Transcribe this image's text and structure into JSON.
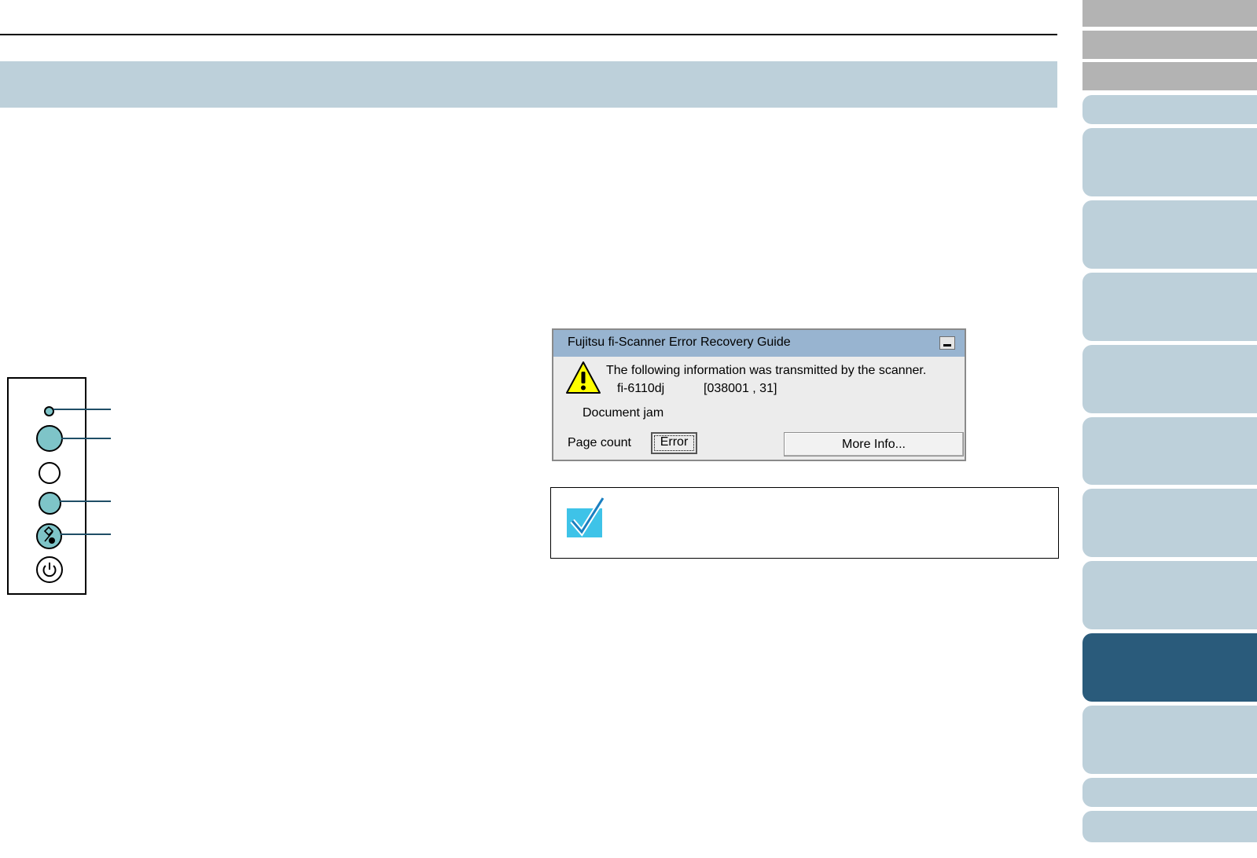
{
  "dialog": {
    "title": "Fujitsu fi-Scanner Error Recovery Guide",
    "message": "The following information was transmitted by the scanner.",
    "model": "fi-6110dj",
    "code": "[038001 , 31]",
    "error_text": "Document jam",
    "page_count_label": "Page count",
    "error_button": "Error",
    "more_info_button": "More Info..."
  },
  "colors": {
    "title_band": "#bdd0da",
    "nav_tab": "#bdd0da",
    "nav_tab_active": "#2a5b7b",
    "nav_tab_gray": "#b3b3b3",
    "led_lit": "#7ec4c8",
    "dialog_titlebar": "#98b4d0"
  },
  "icons": [
    "warning-icon",
    "hint-check-icon",
    "minimize-icon",
    "scan-stop-icon",
    "power-icon"
  ]
}
